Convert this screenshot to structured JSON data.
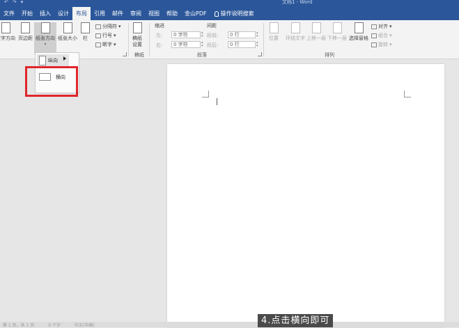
{
  "quick_access": [
    "↶",
    "↷",
    "▾"
  ],
  "doc_title": "文档1 - Word",
  "tabs": [
    "文件",
    "开始",
    "插入",
    "设计",
    "布局",
    "引用",
    "邮件",
    "审阅",
    "视图",
    "帮助",
    "金山PDF"
  ],
  "tell_me": "操作说明搜索",
  "ribbon": {
    "text_direction": "文字方向",
    "margins": "页边距",
    "orientation": "纸张方向",
    "size": "纸张大小",
    "columns": "栏",
    "breaks": "分隔符",
    "line_numbers": "行号",
    "hyphenation": "断字",
    "draft_label": "稿纸",
    "draft_setting": "稿纸\n设置",
    "indent_title": "缩进",
    "spacing_title": "间距",
    "indent_left_label": "左:",
    "indent_left_value": "0 字符",
    "indent_right_label": "右:",
    "indent_right_value": "0 字符",
    "spacing_before_label": "段前:",
    "spacing_before_value": "0 行",
    "spacing_after_label": "段后:",
    "spacing_after_value": "0 行",
    "paragraph_group": "段落",
    "position": "位置",
    "wrap_text": "环绕文字",
    "bring_forward": "上移一层",
    "send_backward": "下移一层",
    "selection_pane": "选择窗格",
    "align": "对齐",
    "group": "组合",
    "rotate": "旋转",
    "arrange_group": "排列"
  },
  "orientation_menu": {
    "portrait": "纵向",
    "landscape": "横向"
  },
  "status": [
    "第 1 页，共 1 页",
    "0 个字",
    "中文(中国)"
  ],
  "caption": "4.点击横向即可",
  "colors": {
    "accent": "#2b579a",
    "highlight_box": "#e0262c"
  }
}
